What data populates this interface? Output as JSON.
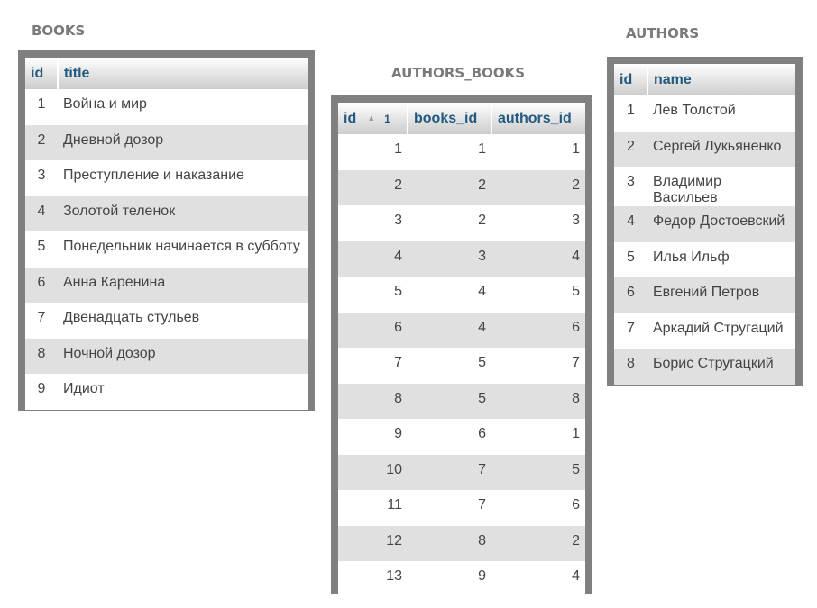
{
  "books": {
    "caption": "BOOKS",
    "columns": [
      "id",
      "title"
    ],
    "rows": [
      {
        "id": "1",
        "title": "Война и мир"
      },
      {
        "id": "2",
        "title": "Дневной дозор"
      },
      {
        "id": "3",
        "title": "Преступление и наказание"
      },
      {
        "id": "4",
        "title": "Золотой теленок"
      },
      {
        "id": "5",
        "title": "Понедельник начинается в субботу"
      },
      {
        "id": "6",
        "title": "Анна Каренина"
      },
      {
        "id": "7",
        "title": "Двенадцать стульев"
      },
      {
        "id": "8",
        "title": "Ночной дозор"
      },
      {
        "id": "9",
        "title": "Идиот"
      }
    ]
  },
  "authors_books": {
    "caption": "AUTHORS_BOOKS",
    "columns": [
      "id",
      "books_id",
      "authors_id"
    ],
    "sort": {
      "icon": "sort-ascending-icon",
      "glyph": "▲",
      "order": "1"
    },
    "rows": [
      {
        "id": "1",
        "books_id": "1",
        "authors_id": "1"
      },
      {
        "id": "2",
        "books_id": "2",
        "authors_id": "2"
      },
      {
        "id": "3",
        "books_id": "2",
        "authors_id": "3"
      },
      {
        "id": "4",
        "books_id": "3",
        "authors_id": "4"
      },
      {
        "id": "5",
        "books_id": "4",
        "authors_id": "5"
      },
      {
        "id": "6",
        "books_id": "4",
        "authors_id": "6"
      },
      {
        "id": "7",
        "books_id": "5",
        "authors_id": "7"
      },
      {
        "id": "8",
        "books_id": "5",
        "authors_id": "8"
      },
      {
        "id": "9",
        "books_id": "6",
        "authors_id": "1"
      },
      {
        "id": "10",
        "books_id": "7",
        "authors_id": "5"
      },
      {
        "id": "11",
        "books_id": "7",
        "authors_id": "6"
      },
      {
        "id": "12",
        "books_id": "8",
        "authors_id": "2"
      },
      {
        "id": "13",
        "books_id": "9",
        "authors_id": "4"
      }
    ]
  },
  "authors": {
    "caption": "AUTHORS",
    "columns": [
      "id",
      "name"
    ],
    "rows": [
      {
        "id": "1",
        "name": "Лев Толстой"
      },
      {
        "id": "2",
        "name": "Сергей Лукьяненко"
      },
      {
        "id": "3",
        "name": "Владимир Васильев"
      },
      {
        "id": "4",
        "name": "Федор Достоевский"
      },
      {
        "id": "5",
        "name": "Илья Ильф"
      },
      {
        "id": "6",
        "name": "Евгений Петров"
      },
      {
        "id": "7",
        "name": "Аркадий Стругаций"
      },
      {
        "id": "8",
        "name": "Борис Стругацкий"
      }
    ]
  }
}
